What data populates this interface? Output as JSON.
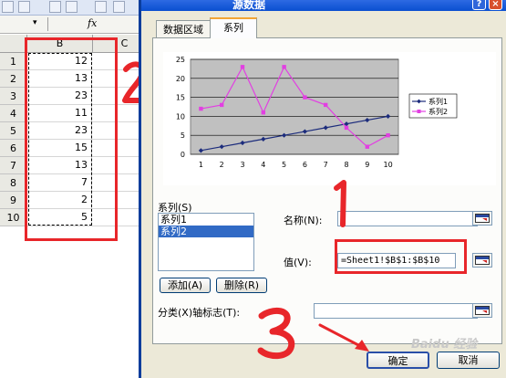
{
  "spreadsheet": {
    "name_box_arrow": "▾",
    "fx_label": "fx",
    "columns": [
      "B",
      "C"
    ],
    "rows": [
      {
        "row": "1",
        "value": "12"
      },
      {
        "row": "2",
        "value": "13"
      },
      {
        "row": "3",
        "value": "23"
      },
      {
        "row": "4",
        "value": "11"
      },
      {
        "row": "5",
        "value": "23"
      },
      {
        "row": "6",
        "value": "15"
      },
      {
        "row": "7",
        "value": "13"
      },
      {
        "row": "8",
        "value": "7"
      },
      {
        "row": "9",
        "value": "2"
      },
      {
        "row": "10",
        "value": "5"
      }
    ]
  },
  "dialog": {
    "title": "源数据",
    "help_label": "?",
    "close_label": "×",
    "tabs": [
      {
        "label": "数据区域",
        "active": false
      },
      {
        "label": "系列",
        "active": true
      }
    ],
    "series_label": "系列(S)",
    "series_list": [
      {
        "label": "系列1",
        "selected": false
      },
      {
        "label": "系列2",
        "selected": true
      }
    ],
    "add_button": "添加(A)",
    "remove_button": "删除(R)",
    "name_label": "名称(N):",
    "name_value": "",
    "value_label": "值(V):",
    "value_value": "=Sheet1!$B$1:$B$10",
    "category_label": "分类(X)轴标志(T):",
    "category_value": "",
    "ok_button": "确定",
    "cancel_button": "取消",
    "watermark": "Baidu 经验"
  },
  "annotations": {
    "mark_2": "2",
    "mark_1": "1",
    "mark_3": "3",
    "color": "#e8262a"
  },
  "colors": {
    "series1": "#1c2c7c",
    "series2": "#e23fe2",
    "plot_background": "#c0c0c0",
    "title_bar": "#0a4fd0"
  },
  "chart_data": {
    "type": "line",
    "x": [
      1,
      2,
      3,
      4,
      5,
      6,
      7,
      8,
      9,
      10
    ],
    "ylim": [
      0,
      25
    ],
    "yticks": [
      0,
      5,
      10,
      15,
      20,
      25
    ],
    "legend_position": "right",
    "grid": true,
    "series": [
      {
        "name": "系列1",
        "values": [
          1,
          2,
          3,
          4,
          5,
          6,
          7,
          8,
          9,
          10
        ],
        "color": "#1c2c7c",
        "marker": "diamond"
      },
      {
        "name": "系列2",
        "values": [
          12,
          13,
          23,
          11,
          23,
          15,
          13,
          7,
          2,
          5
        ],
        "color": "#e23fe2",
        "marker": "square"
      }
    ]
  }
}
